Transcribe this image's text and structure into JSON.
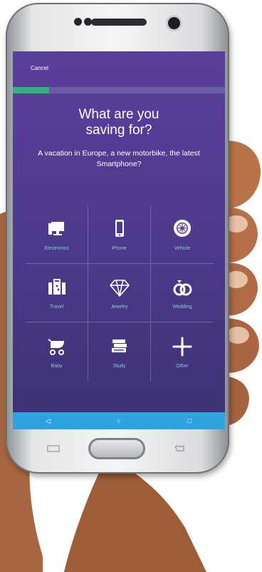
{
  "header": {
    "cancel_label": "Cancel"
  },
  "progress": {
    "value": 0.17
  },
  "question": {
    "title": "What are you\nsaving for?",
    "subtitle": "A vacation in Europe, a new motorbike, the latest Smartphone?"
  },
  "categories": [
    {
      "label": "Electronics",
      "icon": "monitor-icon"
    },
    {
      "label": "Phone",
      "icon": "phone-icon"
    },
    {
      "label": "Vehicle",
      "icon": "wheel-icon"
    },
    {
      "label": "Travel",
      "icon": "suitcase-icon"
    },
    {
      "label": "Jewelry",
      "icon": "diamond-icon"
    },
    {
      "label": "Wedding",
      "icon": "rings-icon"
    },
    {
      "label": "Baby",
      "icon": "stroller-icon"
    },
    {
      "label": "Study",
      "icon": "books-icon"
    },
    {
      "label": "Other",
      "icon": "plus-icon"
    }
  ],
  "navbar": {
    "back": "◁",
    "home": "○",
    "recents": "□"
  },
  "colors": {
    "screen": "#4f3a8e",
    "accent": "#34b27a",
    "label": "#7fd1d8",
    "navbar": "#2fa3df"
  }
}
